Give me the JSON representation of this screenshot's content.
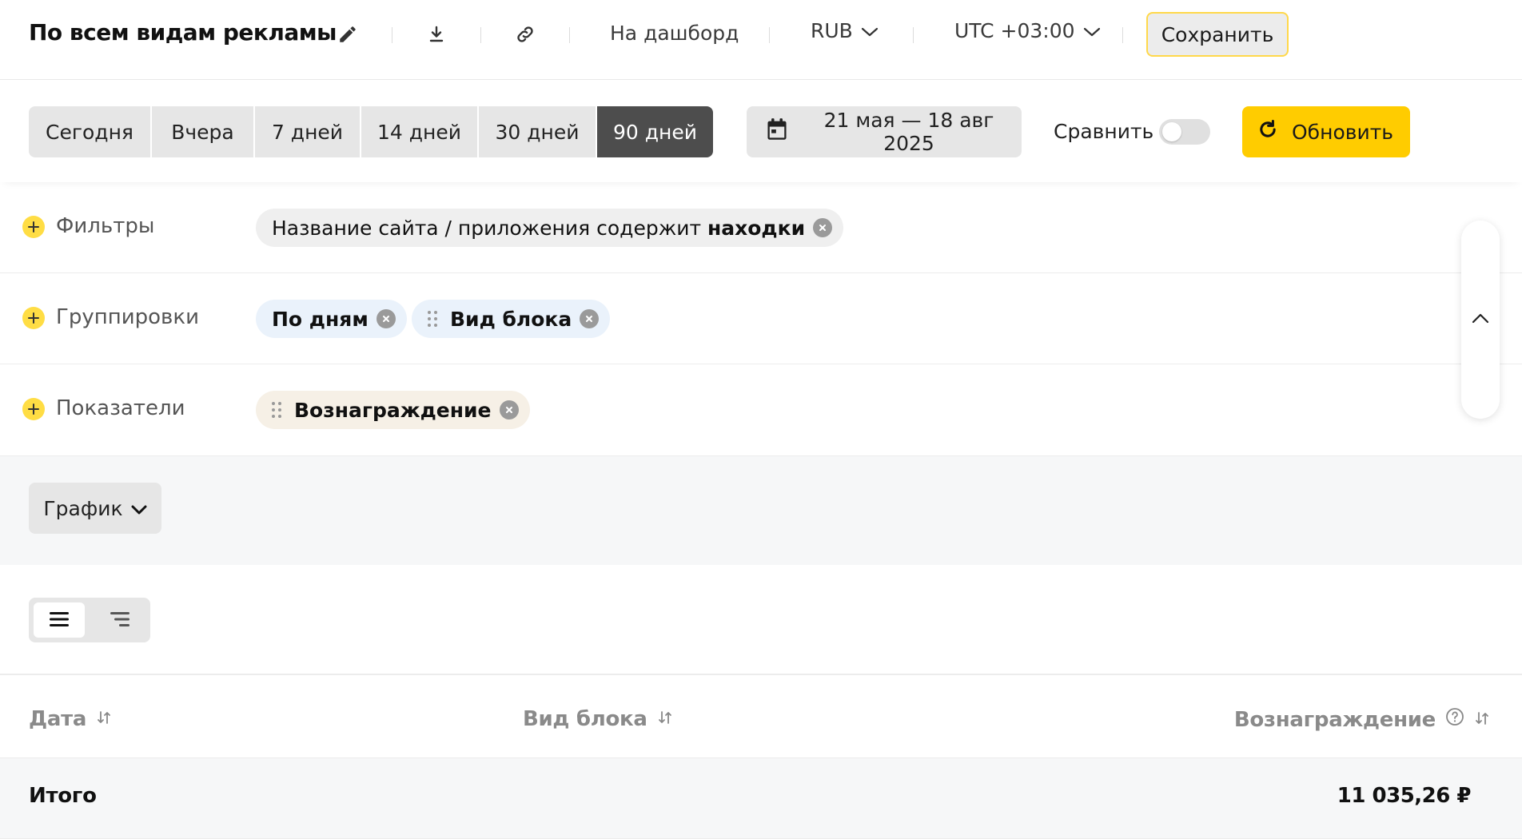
{
  "header": {
    "title": "По всем видам рекламы",
    "edit_icon": "pencil-icon",
    "download_icon": "download-icon",
    "link_icon": "link-icon",
    "dashboard_link": "На дашборд",
    "currency": "RUB",
    "timezone": "UTC +03:00",
    "save_label": "Сохранить"
  },
  "period": {
    "presets": [
      "Сегодня",
      "Вчера",
      "7 дней",
      "14 дней",
      "30 дней",
      "90 дней"
    ],
    "active": "90 дней",
    "date_range": "21 мая — 18 авг 2025",
    "compare_label": "Сравнить",
    "compare_enabled": false,
    "refresh_label": "Обновить"
  },
  "filters": {
    "label": "Фильтры",
    "chip_prefix": "Название сайта / приложения содержит",
    "chip_value": "находки"
  },
  "groupings": {
    "label": "Группировки",
    "items": [
      "По дням",
      "Вид блока"
    ]
  },
  "metrics": {
    "label": "Показатели",
    "items": [
      "Вознаграждение"
    ]
  },
  "chart": {
    "label": "График"
  },
  "table": {
    "columns": [
      "Дата",
      "Вид блока",
      "Вознаграждение"
    ],
    "total_label": "Итого",
    "total_value": "11 035,26 ₽"
  },
  "colors": {
    "accent": "#ffcc00",
    "active_preset": "#4d4d4d",
    "plus_icon": "#ffdd44"
  }
}
